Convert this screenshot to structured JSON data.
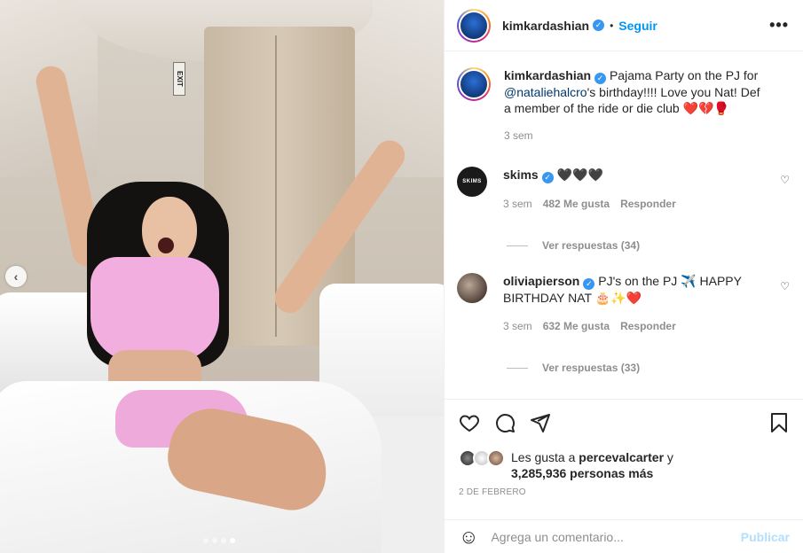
{
  "header": {
    "username": "kimkardashian",
    "bullet": "•",
    "follow_label": "Seguir",
    "more_label": "•••"
  },
  "caption": {
    "username": "kimkardashian",
    "text_part1": "Pajama Party on the PJ for ",
    "mention": "@nataliehalcro",
    "text_part2": "'s birthday!!!! Love you Nat! Def a member of the ride or die club ",
    "emojis": "❤️💔🥊",
    "time": "3 sem"
  },
  "comments": [
    {
      "username": "skims",
      "avatar_text": "SKIMS",
      "text": "🖤🖤🖤",
      "time": "3 sem",
      "likes": "482 Me gusta",
      "reply_label": "Responder",
      "view_replies": "Ver respuestas (34)"
    },
    {
      "username": "oliviapierson",
      "text": "PJ's on the PJ ✈️ HAPPY BIRTHDAY NAT 🎂✨❤️",
      "time": "3 sem",
      "likes": "632 Me gusta",
      "reply_label": "Responder",
      "view_replies": "Ver respuestas (33)"
    }
  ],
  "likes": {
    "prefix": "Les gusta a ",
    "user": "percevalcarter",
    "connector": " y",
    "count": "3,285,936 personas más"
  },
  "date": "2 DE FEBRERO",
  "add_comment": {
    "placeholder": "Agrega un comentario...",
    "post_label": "Publicar"
  },
  "photo": {
    "exit_sign": "EXIT",
    "carousel_prev": "‹",
    "dots_count": 4,
    "active_dot": 3
  },
  "colors": {
    "accent": "#0095f6",
    "verified": "#3897f0",
    "post_disabled": "#b2dffc",
    "muted": "#8e8e8e"
  }
}
